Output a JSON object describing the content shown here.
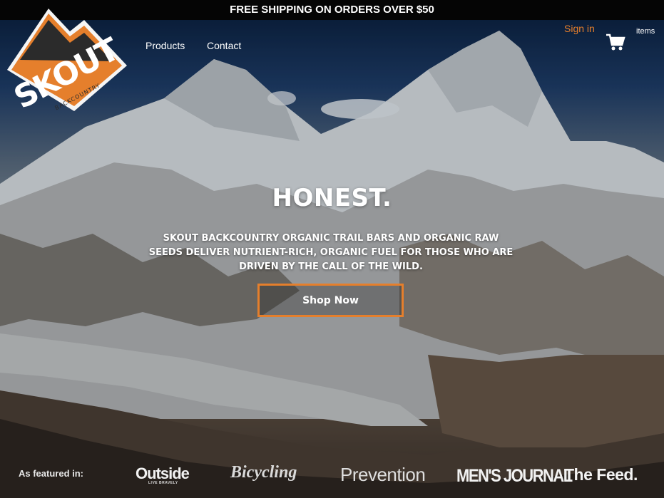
{
  "announcement": {
    "text": "FREE SHIPPING ON ORDERS OVER $50"
  },
  "brand": {
    "logo_text": "SKOUT",
    "logo_subtext": "BACKCOUNTRY",
    "accent_color": "#e57f2c",
    "logo_icon": "skout-logo-icon"
  },
  "nav": {
    "items": [
      {
        "label": "Products"
      },
      {
        "label": "Contact"
      }
    ]
  },
  "account": {
    "signin_label": "Sign in",
    "cart_icon": "shopping-cart-icon",
    "cart_items_label": "items"
  },
  "hero": {
    "headline": "HONEST.",
    "tagline": "SKOUT BACKCOUNTRY ORGANIC TRAIL BARS AND ORGANIC RAW SEEDS DELIVER NUTRIENT-RICH, ORGANIC FUEL FOR THOSE WHO ARE DRIVEN BY THE CALL OF THE WILD.",
    "cta_label": "Shop Now"
  },
  "featured": {
    "label": "As featured in:",
    "logos": [
      {
        "name": "Outside",
        "subtext": "LIVE BRAVELY"
      },
      {
        "name": "Bicycling"
      },
      {
        "name": "Prevention"
      },
      {
        "name": "MEN'S JOURNAL"
      },
      {
        "name": "The Feed."
      }
    ]
  }
}
